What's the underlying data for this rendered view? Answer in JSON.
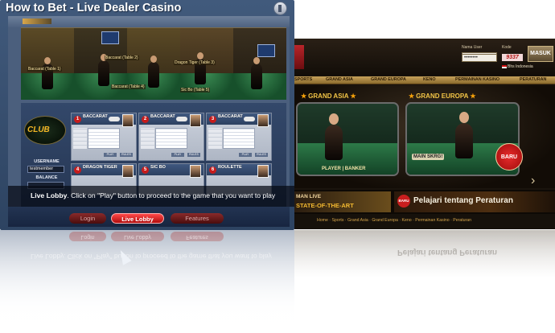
{
  "window": {
    "title": "How to Bet - Live Dealer Casino"
  },
  "video": {
    "labels": [
      "Baccarat (Table 1)",
      "Baccarat (Table 2)",
      "Dragon Tiger (Table 3)",
      "Baccarat (Table 4)",
      "Sic Bo (Table 5)"
    ]
  },
  "lobby": {
    "username_label": "USERNAME",
    "username_value": "testmember",
    "balance_label": "BALANCE",
    "tiles": [
      {
        "num": "1",
        "name": "BACCARAT"
      },
      {
        "num": "2",
        "name": "BACCARAT"
      },
      {
        "num": "3",
        "name": "BACCARAT"
      },
      {
        "num": "4",
        "name": "DRAGON TIGER"
      },
      {
        "num": "5",
        "name": "SIC BO"
      },
      {
        "num": "6",
        "name": "ROULETTE"
      }
    ],
    "tile_buttons": [
      "PLAY",
      "RULES"
    ]
  },
  "caption": {
    "lead": "Live Lobby",
    "text": ". Click on \"Play\" button to proceed to the game that you want to play"
  },
  "nav": {
    "login": "Login",
    "live_lobby": "Live Lobby",
    "features": "Features"
  },
  "site": {
    "login": {
      "user_label": "Nama User",
      "pass_label": "Kode",
      "password_value": "••••••••",
      "captcha": "9337",
      "submit": "MASUK",
      "language": "Bhs Indonesia"
    },
    "menu": [
      "SPORTS",
      "GRAND ASIA",
      "GRAND EUROPA",
      "KENO",
      "PERMAINAN KASINO",
      "PERATURAN"
    ],
    "games": [
      {
        "title": "GRAND ASIA",
        "badge": "PLAYER | BANKER"
      },
      {
        "title": "GRAND EUROPA",
        "badge": "MAIN SKRG!",
        "tag": "BARU"
      }
    ],
    "promo_left_line1": "MAN LIVE",
    "promo_left_line2": "STATE-OF-THE-ART",
    "promo_right_badge": "BARU",
    "promo_right_text": "Pelajari tentang Peraturan",
    "footer_links": "Home · Sports · Grand Asia · Grand Europa · Keno · Permainan Kasino · Peraturan"
  },
  "colors": {
    "accent_red": "#c61b1b",
    "gold": "#f3c546",
    "panel_blue": "#33486a"
  }
}
